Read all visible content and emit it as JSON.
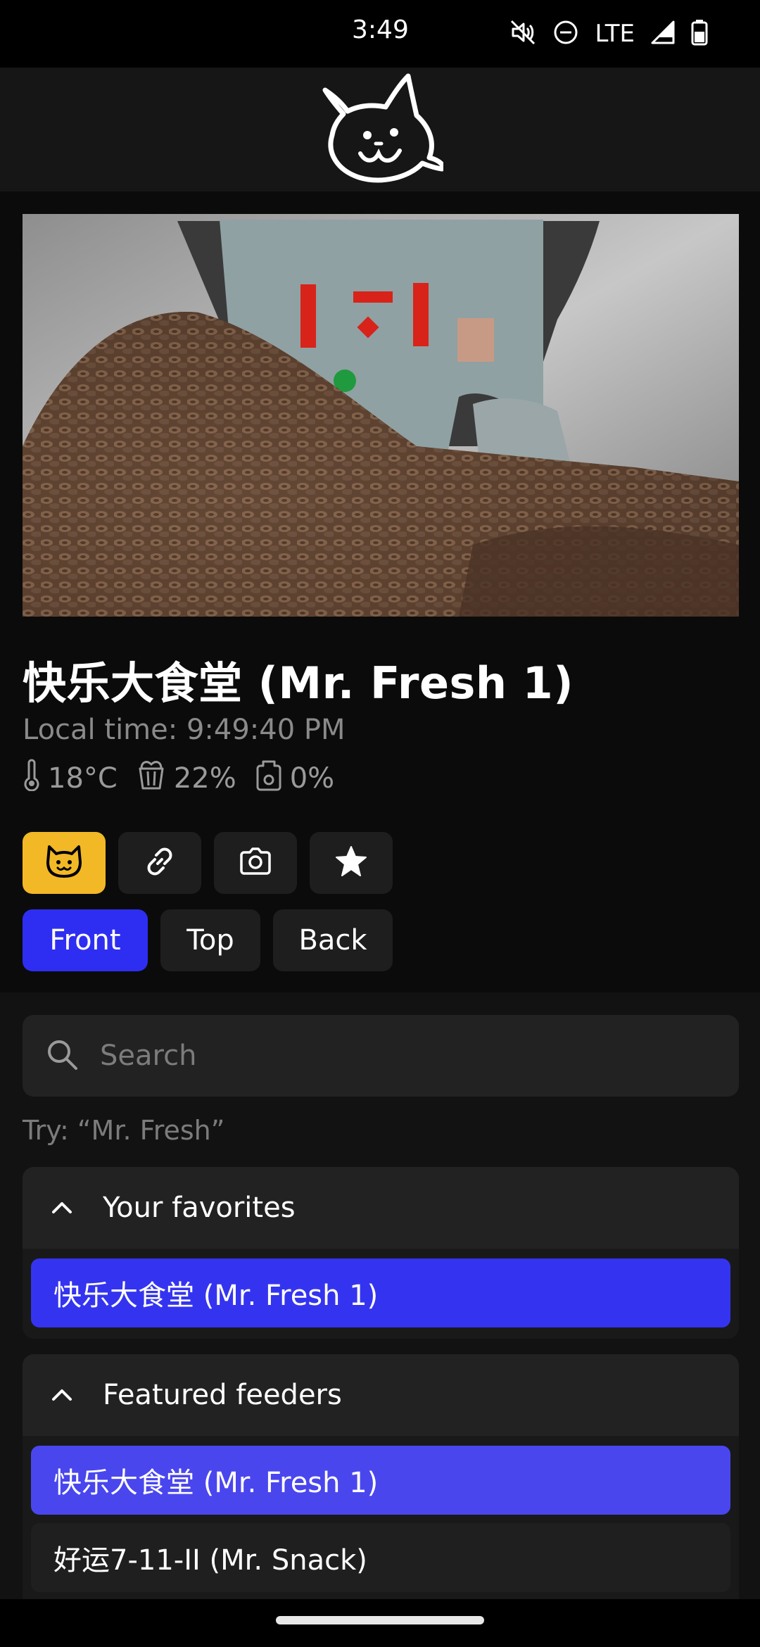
{
  "status_bar": {
    "time": "3:49",
    "network": "LTE",
    "icons": [
      "mute-icon",
      "do-not-disturb-icon",
      "signal-icon",
      "battery-icon"
    ]
  },
  "header": {
    "logo": "cat-logo-icon"
  },
  "feeder": {
    "title": "快乐大食堂 (Mr. Fresh 1)",
    "local_time": "Local time: 9:49:40 PM",
    "temperature": "18°C",
    "food_level": "22%",
    "battery_level": "0%"
  },
  "actions": [
    {
      "icon": "cat-face-icon",
      "active": true
    },
    {
      "icon": "link-icon",
      "active": false
    },
    {
      "icon": "camera-icon",
      "active": false
    },
    {
      "icon": "star-icon",
      "active": false
    }
  ],
  "views": {
    "front": "Front",
    "top": "Top",
    "back": "Back",
    "selected": "Front"
  },
  "search": {
    "placeholder": "Search",
    "hint": "Try: “Mr. Fresh”"
  },
  "favorites": {
    "title": "Your favorites",
    "items": [
      "快乐大食堂 (Mr. Fresh 1)"
    ]
  },
  "featured": {
    "title": "Featured feeders",
    "items": [
      "快乐大食堂 (Mr. Fresh 1)",
      "好运7-11-II (Mr. Snack)"
    ]
  },
  "colors": {
    "accent_yellow": "#f2b826",
    "accent_blue": "#2e2ef2",
    "background": "#0b0b0b"
  }
}
